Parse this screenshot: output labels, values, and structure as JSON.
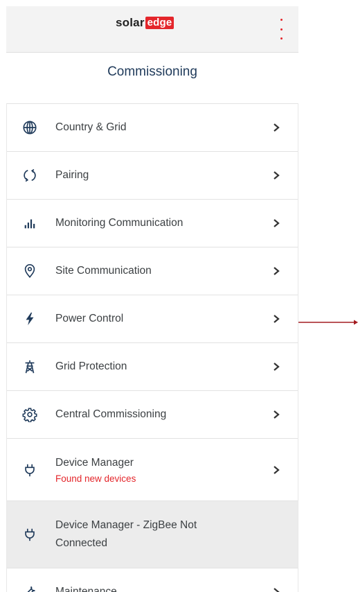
{
  "header": {
    "logo_solar": "solar",
    "logo_edge": "edge",
    "menu_icon": "more-vertical-icon"
  },
  "page_title": "Commissioning",
  "menu_items": [
    {
      "label": "Country & Grid",
      "icon": "globe-icon"
    },
    {
      "label": "Pairing",
      "icon": "sync-icon"
    },
    {
      "label": "Monitoring Communication",
      "icon": "bar-chart-icon"
    },
    {
      "label": "Site Communication",
      "icon": "location-pin-icon"
    },
    {
      "label": "Power Control",
      "icon": "lightning-icon"
    },
    {
      "label": "Grid Protection",
      "icon": "power-tower-icon"
    },
    {
      "label": "Central Commissioning",
      "icon": "gear-icon"
    },
    {
      "label": "Device Manager",
      "sublabel": "Found new devices",
      "icon": "plug-icon"
    },
    {
      "label": "Device Manager - ZigBee Not Connected",
      "icon": "plug-icon",
      "disabled": true
    },
    {
      "label": "Maintenance",
      "icon": "wrench-icon"
    }
  ],
  "colors": {
    "brand_red": "#e4262b",
    "title_blue": "#1f3a5a",
    "header_bg": "#f3f3f3",
    "disabled_bg": "#ececec",
    "annotation_arrow": "#a31b20"
  }
}
